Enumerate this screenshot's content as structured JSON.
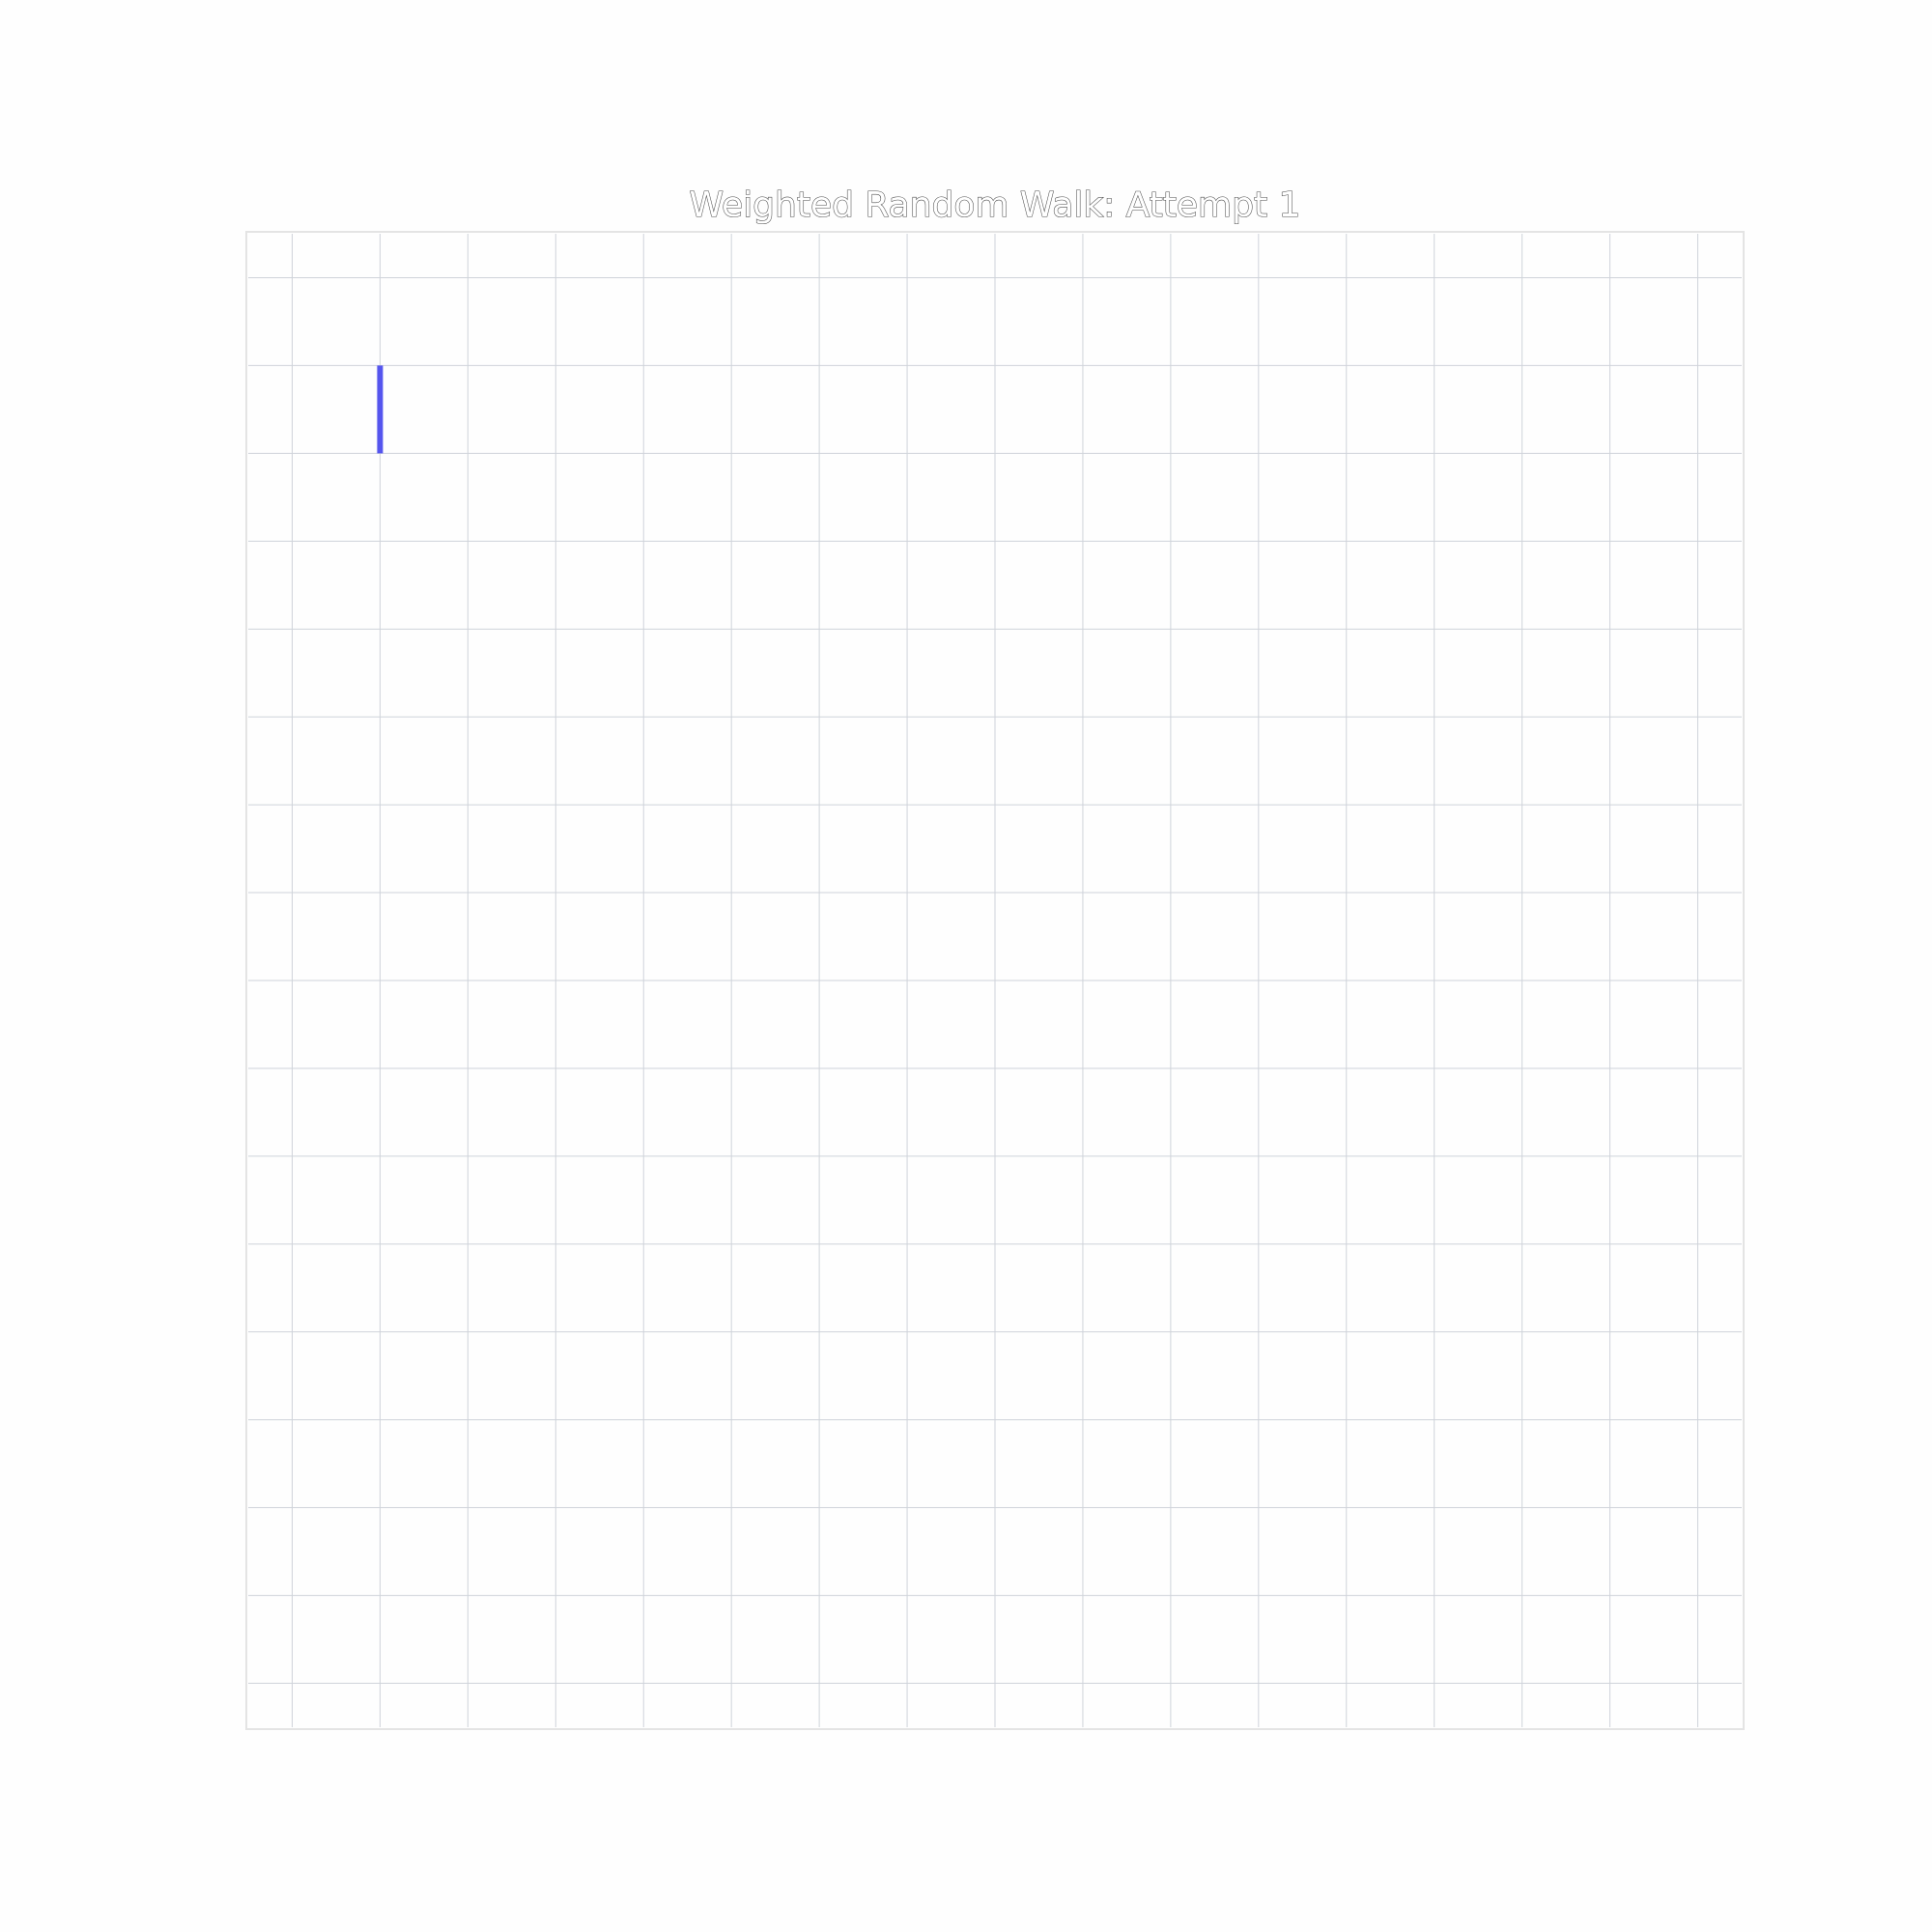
{
  "chart_data": {
    "type": "line",
    "title": "Weighted Random Walk: Attempt 1",
    "xlabel": "",
    "ylabel": "",
    "xlim": [
      -0.5,
      16.5
    ],
    "ylim": [
      -0.5,
      16.5
    ],
    "grid": true,
    "axes_visible": false,
    "series": [
      {
        "color": "#5555ee",
        "x": [
          1,
          1
        ],
        "y": [
          15,
          14
        ]
      }
    ]
  },
  "colors": {
    "background": "#fefefe",
    "grid": "#cfd3da",
    "frame": "#e4e4e4",
    "walk": "#5555ee"
  }
}
